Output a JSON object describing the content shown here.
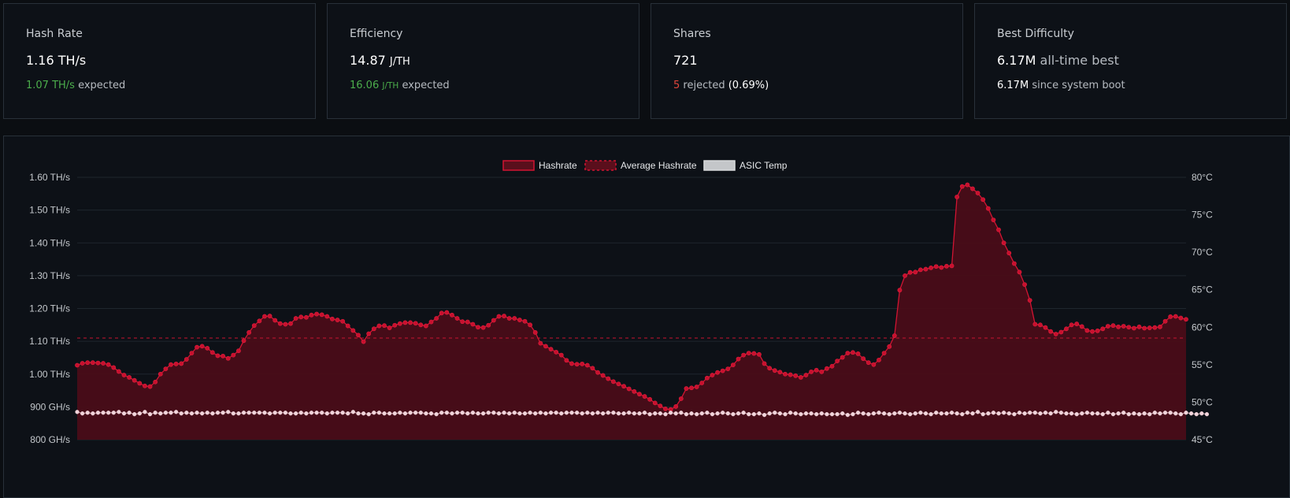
{
  "cards": [
    {
      "title": "Hash Rate",
      "value": "1.16 TH/s",
      "sub_value": "1.07 TH/s",
      "sub_label": "expected"
    },
    {
      "title": "Efficiency",
      "value": "14.87",
      "value_unit": "J/TH",
      "sub_value": "16.06",
      "sub_unit": "J/TH",
      "sub_label": "expected"
    },
    {
      "title": "Shares",
      "value": "721",
      "sub_value": "5",
      "sub_label": "rejected",
      "sub_extra": "(0.69%)"
    },
    {
      "title": "Best Difficulty",
      "value": "6.17M",
      "value_suffix": "all-time best",
      "sub_value": "6.17M",
      "sub_label": "since system boot"
    }
  ],
  "colors": {
    "background": "#0b0e12",
    "panel": "#0d1117",
    "border": "#283039",
    "hashrate": "#d21432",
    "hashrate_fill": "#4a0d18",
    "temp": "#e8c8cf",
    "green": "#4cae4c",
    "red": "#e0463c"
  },
  "chart_data": {
    "type": "line",
    "legend": [
      {
        "label": "Hashrate",
        "icon": "solid-red-box"
      },
      {
        "label": "Average Hashrate",
        "icon": "dashed-red-box"
      },
      {
        "label": "ASIC Temp",
        "icon": "gray-box"
      }
    ],
    "legend_position": "top-center",
    "grid": true,
    "y_left_ticks": [
      "800 GH/s",
      "900 GH/s",
      "1.00 TH/s",
      "1.10 TH/s",
      "1.20 TH/s",
      "1.30 TH/s",
      "1.40 TH/s",
      "1.50 TH/s",
      "1.60 TH/s"
    ],
    "y_right_ticks": [
      "45°C",
      "50°C",
      "55°C",
      "60°C",
      "65°C",
      "70°C",
      "75°C",
      "80°C"
    ],
    "ylim_left_ghs": [
      800,
      1600
    ],
    "ylim_right_c": [
      45,
      80
    ],
    "average_hashrate_ghs": 1110,
    "series": [
      {
        "name": "Hashrate",
        "unit": "GH/s",
        "values": [
          1027,
          1033,
          1035,
          1035,
          1034,
          1033,
          1029,
          1020,
          1008,
          997,
          990,
          981,
          972,
          964,
          962,
          976,
          1000,
          1016,
          1029,
          1031,
          1032,
          1045,
          1064,
          1082,
          1085,
          1079,
          1066,
          1056,
          1055,
          1048,
          1058,
          1071,
          1102,
          1127,
          1148,
          1162,
          1176,
          1177,
          1164,
          1154,
          1152,
          1154,
          1170,
          1174,
          1173,
          1180,
          1183,
          1181,
          1176,
          1168,
          1165,
          1161,
          1147,
          1133,
          1119,
          1099,
          1123,
          1138,
          1147,
          1148,
          1141,
          1149,
          1154,
          1157,
          1157,
          1155,
          1150,
          1147,
          1159,
          1170,
          1186,
          1188,
          1180,
          1170,
          1160,
          1159,
          1152,
          1143,
          1142,
          1149,
          1164,
          1176,
          1177,
          1170,
          1170,
          1165,
          1161,
          1150,
          1127,
          1094,
          1085,
          1076,
          1067,
          1058,
          1042,
          1032,
          1030,
          1031,
          1027,
          1018,
          1005,
          996,
          986,
          977,
          970,
          963,
          955,
          947,
          939,
          932,
          923,
          912,
          903,
          894,
          892,
          901,
          925,
          956,
          958,
          961,
          973,
          988,
          997,
          1005,
          1010,
          1016,
          1028,
          1046,
          1058,
          1064,
          1063,
          1060,
          1032,
          1018,
          1011,
          1006,
          1000,
          998,
          995,
          990,
          997,
          1007,
          1012,
          1007,
          1017,
          1024,
          1040,
          1051,
          1064,
          1066,
          1062,
          1047,
          1035,
          1029,
          1043,
          1064,
          1084,
          1117,
          1256,
          1300,
          1310,
          1311,
          1318,
          1320,
          1324,
          1328,
          1325,
          1329,
          1330,
          1540,
          1572,
          1577,
          1565,
          1552,
          1532,
          1505,
          1470,
          1440,
          1400,
          1369,
          1337,
          1311,
          1273,
          1225,
          1152,
          1150,
          1142,
          1130,
          1122,
          1128,
          1138,
          1150,
          1153,
          1145,
          1133,
          1130,
          1132,
          1138,
          1146,
          1148,
          1144,
          1146,
          1143,
          1140,
          1144,
          1140,
          1141,
          1142,
          1144,
          1161,
          1175,
          1176,
          1171,
          1167
        ]
      },
      {
        "name": "ASIC Temp",
        "unit": "°C",
        "values": [
          48.7,
          48.5,
          48.6,
          48.5,
          48.6,
          48.6,
          48.6,
          48.6,
          48.7,
          48.5,
          48.6,
          48.4,
          48.5,
          48.7,
          48.4,
          48.6,
          48.5,
          48.6,
          48.6,
          48.7,
          48.5,
          48.6,
          48.5,
          48.6,
          48.5,
          48.6,
          48.5,
          48.6,
          48.6,
          48.7,
          48.5,
          48.5,
          48.6,
          48.6,
          48.6,
          48.6,
          48.6,
          48.5,
          48.6,
          48.6,
          48.6,
          48.5,
          48.5,
          48.6,
          48.5,
          48.6,
          48.6,
          48.6,
          48.5,
          48.6,
          48.6,
          48.6,
          48.5,
          48.7,
          48.5,
          48.5,
          48.4,
          48.6,
          48.6,
          48.5,
          48.5,
          48.5,
          48.6,
          48.5,
          48.6,
          48.6,
          48.6,
          48.5,
          48.5,
          48.4,
          48.6,
          48.6,
          48.5,
          48.6,
          48.6,
          48.5,
          48.6,
          48.5,
          48.5,
          48.6,
          48.6,
          48.5,
          48.6,
          48.5,
          48.6,
          48.5,
          48.5,
          48.6,
          48.5,
          48.6,
          48.5,
          48.6,
          48.6,
          48.5,
          48.6,
          48.6,
          48.6,
          48.5,
          48.6,
          48.5,
          48.6,
          48.5,
          48.6,
          48.6,
          48.5,
          48.5,
          48.6,
          48.5,
          48.5,
          48.6,
          48.4,
          48.5,
          48.5,
          48.4,
          48.6,
          48.5,
          48.6,
          48.4,
          48.5,
          48.4,
          48.5,
          48.6,
          48.4,
          48.5,
          48.6,
          48.5,
          48.4,
          48.5,
          48.6,
          48.4,
          48.4,
          48.5,
          48.3,
          48.5,
          48.6,
          48.5,
          48.4,
          48.6,
          48.5,
          48.4,
          48.5,
          48.5,
          48.4,
          48.5,
          48.4,
          48.4,
          48.4,
          48.5,
          48.3,
          48.4,
          48.6,
          48.5,
          48.4,
          48.5,
          48.6,
          48.5,
          48.4,
          48.5,
          48.6,
          48.5,
          48.4,
          48.5,
          48.6,
          48.5,
          48.4,
          48.6,
          48.5,
          48.5,
          48.6,
          48.5,
          48.4,
          48.6,
          48.5,
          48.7,
          48.4,
          48.5,
          48.6,
          48.5,
          48.6,
          48.5,
          48.4,
          48.6,
          48.5,
          48.6,
          48.6,
          48.5,
          48.6,
          48.5,
          48.7,
          48.6,
          48.5,
          48.5,
          48.4,
          48.5,
          48.6,
          48.5,
          48.5,
          48.4,
          48.6,
          48.4,
          48.5,
          48.6,
          48.4,
          48.5,
          48.4,
          48.5,
          48.4,
          48.6,
          48.5,
          48.6,
          48.6,
          48.5,
          48.4,
          48.6,
          48.5,
          48.4,
          48.5,
          48.4
        ]
      }
    ]
  }
}
